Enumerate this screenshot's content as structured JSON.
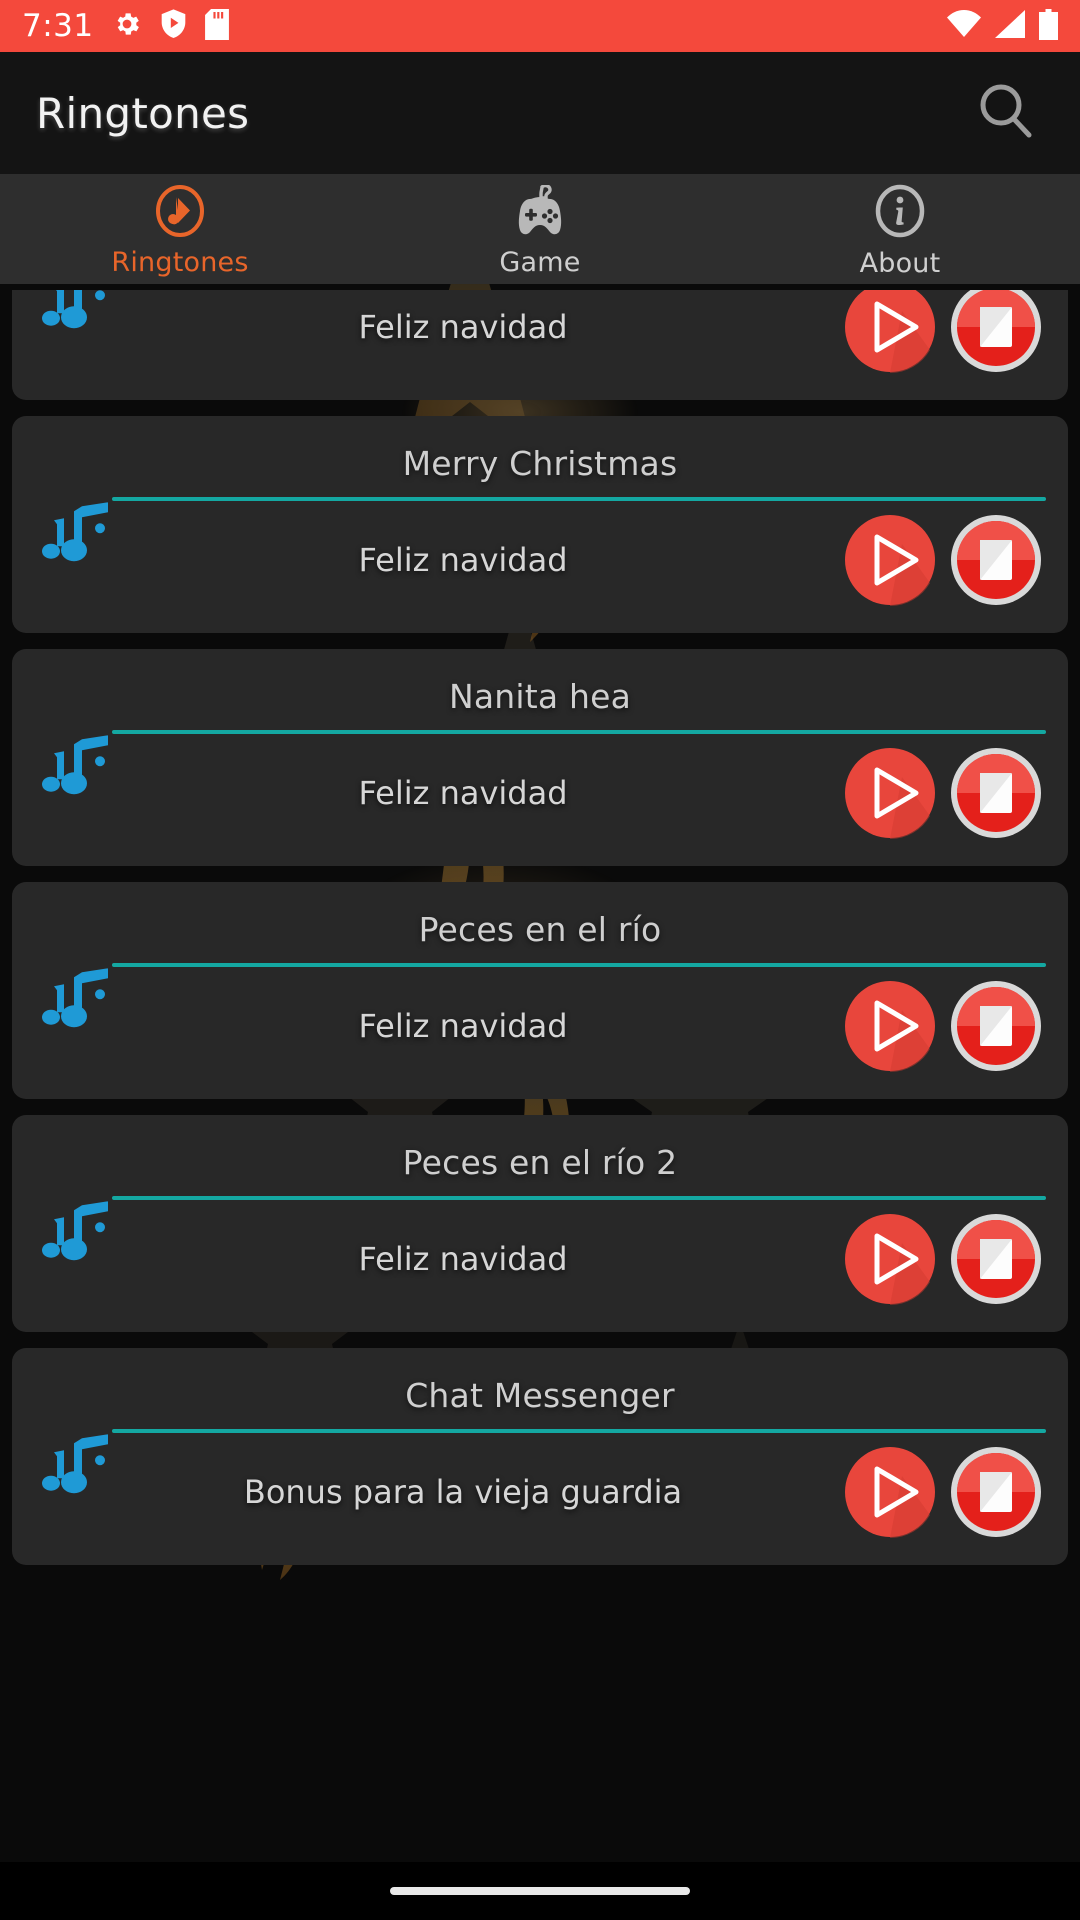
{
  "status_bar": {
    "time": "7:31",
    "left_icons": [
      "gear-icon",
      "shield-play-icon",
      "sd-card-icon"
    ],
    "right_icons": [
      "wifi-icon",
      "cellular-signal-icon",
      "battery-icon"
    ],
    "background_color": "#f4493c"
  },
  "app_bar": {
    "title": "Ringtones",
    "search_icon": "search-icon",
    "background_color": "#141414"
  },
  "tabs": {
    "active_color": "#e8652a",
    "inactive_color": "#cfcfcf",
    "items": [
      {
        "label": "Ringtones",
        "icon": "music-note-circle-icon",
        "active": true
      },
      {
        "label": "Game",
        "icon": "gamepad-icon",
        "active": false
      },
      {
        "label": "About",
        "icon": "info-circle-icon",
        "active": false
      }
    ]
  },
  "list": {
    "divider_color": "#14a8a2",
    "note_icon_color": "#1d9bd7",
    "play_button_color": "#e8453c",
    "stop_button_color": "#e01b16",
    "items": [
      {
        "title": "",
        "subtitle": "Feliz navidad",
        "clipped": true,
        "play_label": "play-ringtone",
        "stop_label": "stop-ringtone"
      },
      {
        "title": "Merry Christmas",
        "subtitle": "Feliz navidad",
        "clipped": false,
        "play_label": "play-ringtone",
        "stop_label": "stop-ringtone"
      },
      {
        "title": "Nanita hea",
        "subtitle": "Feliz navidad",
        "clipped": false,
        "play_label": "play-ringtone",
        "stop_label": "stop-ringtone"
      },
      {
        "title": "Peces en el río",
        "subtitle": "Feliz navidad",
        "clipped": false,
        "play_label": "play-ringtone",
        "stop_label": "stop-ringtone"
      },
      {
        "title": "Peces en el río 2",
        "subtitle": "Feliz navidad",
        "clipped": false,
        "play_label": "play-ringtone",
        "stop_label": "stop-ringtone"
      },
      {
        "title": "Chat Messenger",
        "subtitle": "Bonus para la vieja guardia",
        "clipped": false,
        "play_label": "play-ringtone",
        "stop_label": "stop-ringtone"
      }
    ]
  },
  "home_indicator": {
    "name": "home-gesture-bar"
  }
}
